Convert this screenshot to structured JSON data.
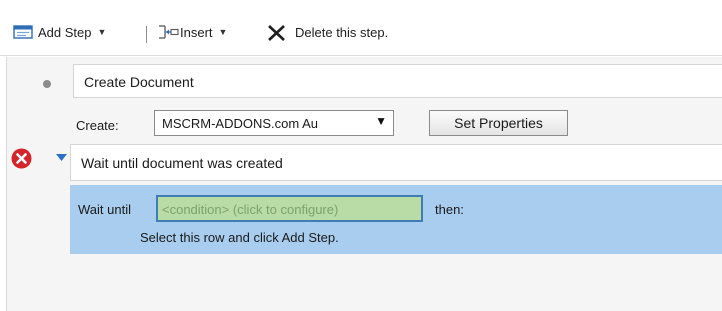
{
  "toolbar": {
    "add_step_label": "Add Step",
    "insert_label": "Insert",
    "delete_label": "Delete this step.",
    "add_icon": "add-step-icon",
    "insert_icon": "insert-icon",
    "delete_icon": "delete-x-icon",
    "dropdown_icon": "chevron-down-icon"
  },
  "step1": {
    "title": "Create Document",
    "create_label": "Create:",
    "entity_selected": "MSCRM-ADDONS.com Au",
    "set_properties_label": "Set Properties"
  },
  "step2": {
    "status_icon": "error-icon",
    "title": "Wait until document was created"
  },
  "condition": {
    "wait_until_label": "Wait until",
    "placeholder": "<condition> (click to configure)",
    "then_label": "then:",
    "hint": "Select this row and click Add Step."
  },
  "colors": {
    "selection_row": "#a8cdee",
    "condition_fill": "#b9dba6",
    "condition_border": "#3f7db4",
    "error_red": "#d4232b",
    "accent_blue": "#2a6fc9"
  }
}
